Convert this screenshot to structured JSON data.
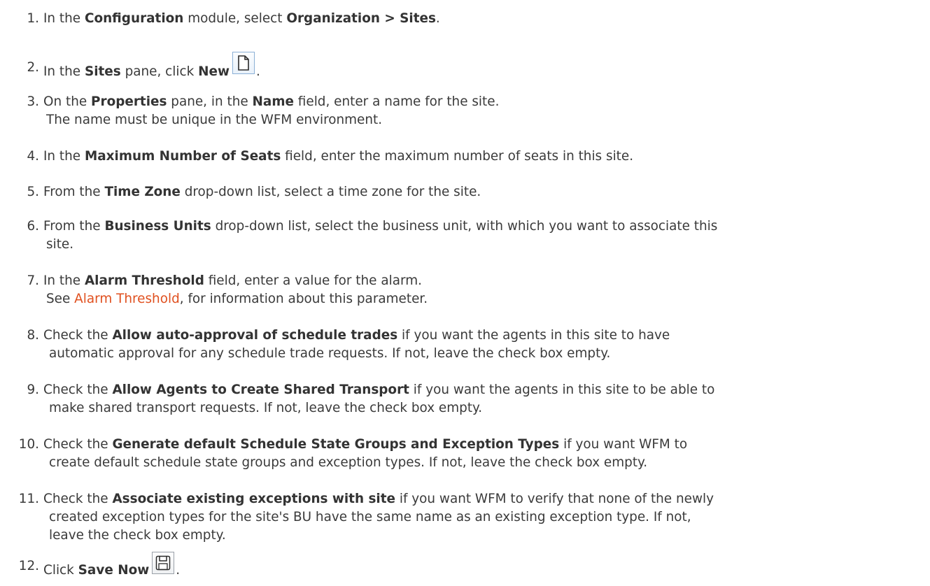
{
  "steps": [
    {
      "num": "1.",
      "p1": "In the ",
      "b1": "Configuration",
      "p2": " module, select ",
      "b2": "Organization > Sites",
      "p3": "."
    },
    {
      "num": "2.",
      "p1": "In the ",
      "b1": "Sites",
      "p2": " pane, click ",
      "b2": "New",
      "p3": ".",
      "icon": "new-document-icon"
    },
    {
      "num": "3.",
      "p1": "On the ",
      "b1": "Properties",
      "p2": " pane, in the ",
      "b2": "Name",
      "p3": " field, enter a name for the site.",
      "line2": "The name must be unique in the WFM environment."
    },
    {
      "num": "4.",
      "p1": "In the ",
      "b1": "Maximum Number of Seats",
      "p2": " field, enter the maximum number of seats in this site."
    },
    {
      "num": "5.",
      "p1": "From the ",
      "b1": "Time Zone",
      "p2": " drop-down list, select a time zone for the site."
    },
    {
      "num": "6.",
      "p1": "From the ",
      "b1": "Business Units",
      "p2": " drop-down list, select the business unit, with which you want to associate this",
      "line2": "site."
    },
    {
      "num": "7.",
      "p1": "In the ",
      "b1": "Alarm Threshold",
      "p2": " field, enter a value for the alarm.",
      "line2_pre": "See ",
      "line2_link": "Alarm Threshold",
      "line2_post": ", for information about this parameter."
    },
    {
      "num": "8.",
      "p1": "Check the ",
      "b1": "Allow auto-approval of schedule trades",
      "p2": " if you want the agents in this site to have",
      "line2": "automatic approval for any schedule trade requests. If not, leave the check box empty."
    },
    {
      "num": "9.",
      "p1": "Check the ",
      "b1": "Allow Agents to Create Shared Transport",
      "p2": " if you want the agents in this site to be able to",
      "line2": "make shared transport requests. If not, leave the check box empty."
    },
    {
      "num": "10.",
      "p1": "Check the ",
      "b1": "Generate default Schedule State Groups and Exception Types",
      "p2": " if you want WFM to",
      "line2": "create default schedule state groups and exception types. If not, leave the check box empty."
    },
    {
      "num": "11.",
      "p1": "Check the ",
      "b1": "Associate existing exceptions with site",
      "p2": " if you want WFM to verify that none of the newly",
      "line2": "created exception types for the site's BU have the same name as an existing exception type. If not,",
      "line3": "leave the check box empty."
    },
    {
      "num": "12.",
      "p1": "Click ",
      "b1": "Save Now",
      "p3": ".",
      "icon": "save-icon"
    }
  ],
  "colors": {
    "text": "#3a3a3a",
    "link": "#e0501f"
  }
}
